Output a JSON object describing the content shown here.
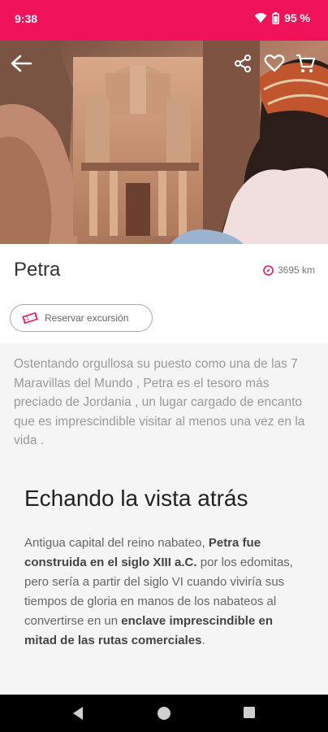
{
  "status_bar": {
    "time": "9:38",
    "battery": "95 %"
  },
  "header": {
    "back_icon": "arrow-left-icon",
    "share_icon": "share-icon",
    "favorite_icon": "heart-icon",
    "cart_icon": "cart-icon"
  },
  "place": {
    "title": "Petra",
    "distance": "3695 km"
  },
  "reserve_button": {
    "label": "Reservar excursión"
  },
  "intro": {
    "parts": [
      "Ostentando orgullosa su puesto como  una de las 7 Maravillas del Mundo ,  Petra es el tesoro más preciado de Jordania , un lugar cargado de encanto que es  imprescindible visitar al menos una vez en la vida ."
    ]
  },
  "section": {
    "title": "Echando la vista atrás",
    "p1": "Antigua capital del reino nabateo, ",
    "b1": "Petra fue construida en el siglo XIII a.C.",
    "p2": " por los edomitas, pero sería a partir del siglo VI cuando viviría sus tiempos de gloria en manos de los nabateos al convertirse en un ",
    "b2": "enclave imprescindible en mitad de las rutas comerciales",
    "p3": "."
  },
  "colors": {
    "accent": "#f0135a"
  }
}
